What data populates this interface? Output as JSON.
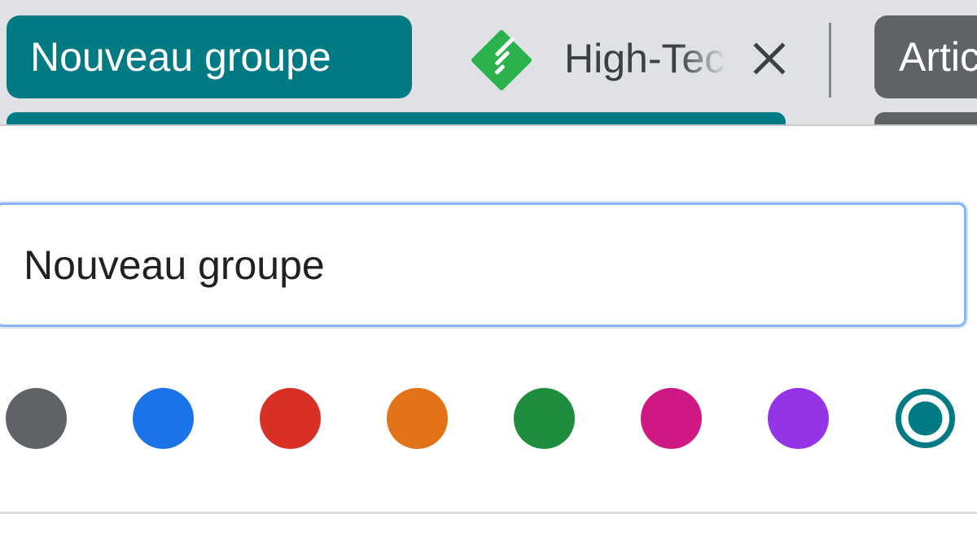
{
  "tabstrip": {
    "group": {
      "label": "Nouveau groupe",
      "color": "#007b83"
    },
    "tab": {
      "title": "High-Tech",
      "favicon": "feedly-icon",
      "favicon_color": "#2bb24c"
    },
    "next_group": {
      "label": "Articles",
      "color": "#5f6368"
    }
  },
  "editor": {
    "name_value": "Nouveau groupe",
    "colors": [
      {
        "name": "grey",
        "hex": "#5f6368"
      },
      {
        "name": "blue",
        "hex": "#1a73e8"
      },
      {
        "name": "red",
        "hex": "#d93025"
      },
      {
        "name": "yellow",
        "hex": "#e37318"
      },
      {
        "name": "green",
        "hex": "#1e8e3e"
      },
      {
        "name": "pink",
        "hex": "#d01884"
      },
      {
        "name": "purple",
        "hex": "#9334e6"
      },
      {
        "name": "cyan",
        "hex": "#007b83"
      }
    ],
    "selected_color": "cyan"
  }
}
